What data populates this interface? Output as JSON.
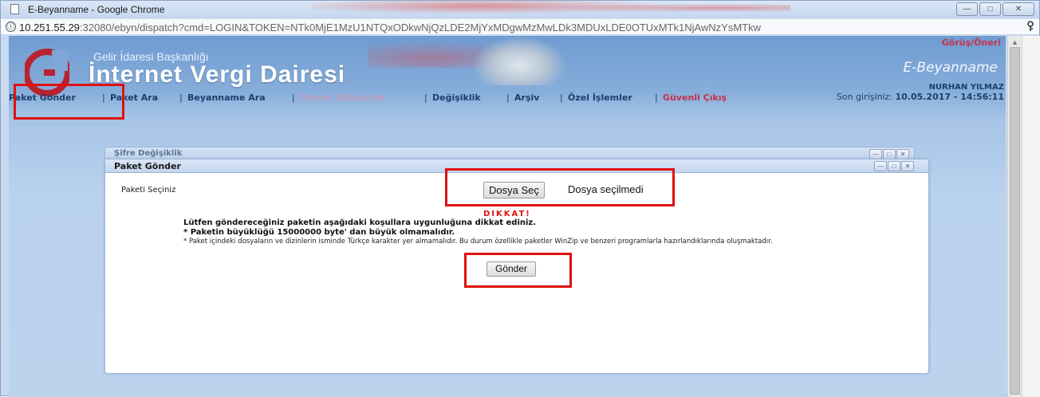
{
  "browser": {
    "window_title": "E-Beyanname - Google Chrome",
    "url_host": "10.251.55.29",
    "url_rest": ":32080/ebyn/dispatch?cmd=LOGIN&TOKEN=NTk0MjE1MzU1NTQxODkwNjQzLDE2MjYxMDgwMzMwLDk3MDUxLDE0OTUxMTk1NjAwNzYsMTkw",
    "info_icon": "ⓘ",
    "window_buttons": {
      "minimize": "—",
      "maximize": "□",
      "close": "✕"
    }
  },
  "header": {
    "brand_small": "Gelir İdaresi Başkanlığı",
    "brand_big": "İnternet Vergi Dairesi",
    "feedback_link": "Görüş/Öneri",
    "product_name": "E-Beyanname",
    "user_name": "NURHAN YILMAZ",
    "last_login_label": "Son girişiniz:",
    "last_login_value": "10.05.2017 - 14:56:11"
  },
  "nav": {
    "items": [
      {
        "label": "Paket Gönder"
      },
      {
        "label": "Paket Ara"
      },
      {
        "label": "Beyanname Ara"
      },
      {
        "label": "Ödeme Tablosu Ara"
      },
      {
        "label": "Değişiklik"
      },
      {
        "label": "Arşiv"
      },
      {
        "label": "Özel İşlemler"
      },
      {
        "label": "Güvenli Çıkış"
      }
    ],
    "separator": "|"
  },
  "background_dialog": {
    "title": "Şifre Değişiklik"
  },
  "dialog": {
    "title": "Paket Gönder",
    "select_label": "Paketi Seçiniz",
    "file_button": "Dosya Seç",
    "file_status": "Dosya seçilmedi",
    "warning_heading": "DIKKAT!",
    "warning_line1": "Lütfen göndereceğiniz paketin aşağıdaki koşullara uygunluğuna dikkat ediniz.",
    "warning_line2": "* Paketin büyüklüğü 15000000 byte' dan büyük olmamalıdır.",
    "warning_line3": "* Paket içindeki dosyaların ve dizinlerin isminde Türkçe karakter yer almamalıdır. Bu durum özellikle paketler WinZip ve benzeri programlarla hazırlandıklarında oluşmaktadır.",
    "send_button": "Gönder"
  },
  "colors": {
    "highlight_box": "#e01010",
    "nav_text": "#1b3f6e",
    "nav_pink": "#d88fa8",
    "logout_red": "#c7314a"
  }
}
